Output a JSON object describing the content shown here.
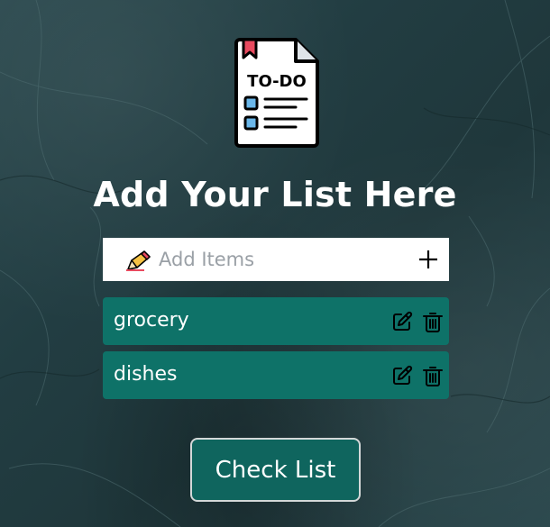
{
  "app": {
    "title": "Add Your List Here",
    "logo_icon": "todo-document-icon",
    "logo_text": "TO-DO"
  },
  "input": {
    "placeholder": "Add Items",
    "value": "",
    "leading_icon": "pencil-icon",
    "add_icon": "plus-icon"
  },
  "items": [
    {
      "label": "grocery",
      "edit_icon": "edit-icon",
      "delete_icon": "trash-icon"
    },
    {
      "label": "dishes",
      "edit_icon": "edit-icon",
      "delete_icon": "trash-icon"
    }
  ],
  "actions": {
    "check_label": "Check List"
  },
  "colors": {
    "item_bg": "#0e7268",
    "button_bg": "#0f655e",
    "title": "#ffffff",
    "logo_accent": "#e94a5f",
    "logo_box": "#6ab7ea"
  }
}
